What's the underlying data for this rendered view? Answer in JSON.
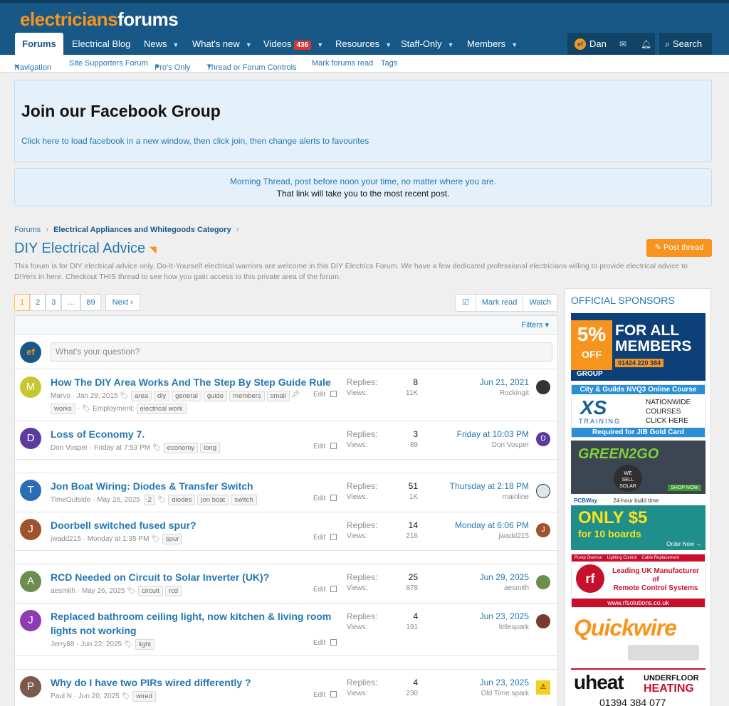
{
  "site": {
    "logo_a": "electricians",
    "logo_b": "forums"
  },
  "nav": {
    "tabs": [
      {
        "label": "Forums"
      },
      {
        "label": "Electrical Blog"
      },
      {
        "label": "News"
      },
      {
        "label": "What's new"
      },
      {
        "label": "Videos",
        "badge": "436"
      },
      {
        "label": "Resources"
      },
      {
        "label": "Staff-Only"
      },
      {
        "label": "Members"
      }
    ],
    "user": "Dan",
    "search": "Search"
  },
  "subnav": [
    "Navigation",
    "Site Supporters Forum",
    "Pro's Only",
    "Thread or Forum Controls",
    "Mark forums read",
    "Tags"
  ],
  "notice_fb": {
    "title": "Join our Facebook Group",
    "link": "Click here to load facebook in a new window, then click join, then change alerts to favourites"
  },
  "notice_morning": {
    "line1": "Morning Thread, post before noon your time, no matter where you are.",
    "line2": "That link will take you to the most recent post."
  },
  "breadcrumb": {
    "root": "Forums",
    "category": "Electrical Appliances and Whitegoods Category"
  },
  "forum": {
    "title": "DIY Electrical Advice",
    "post_thread": "Post thread",
    "description": "This forum is for DIY electrical advice only. Do-It-Yourself electrical warriors are welcome in this DIY Electrics Forum. We have a few dedicated professional electricians willing to provide electrical advice to DIYers in here. Checkout THIS thread to see how you gain access to this private area of the forum."
  },
  "pagination": {
    "pages": [
      "1",
      "2",
      "3",
      "…",
      "89"
    ],
    "next": "Next ›"
  },
  "actions": {
    "mark_read": "Mark read",
    "watch": "Watch"
  },
  "filters": "Filters ▾",
  "ask_placeholder": "What's your question?",
  "labels": {
    "replies": "Replies:",
    "views": "Views:",
    "edit": "Edit",
    "employment": "Employment:"
  },
  "threads": [
    {
      "title": "How The DIY Area Works And The Step By Step Guide Rule",
      "author": "Marvo",
      "date": "Jan 29, 2015",
      "tags": [
        "area",
        "diy",
        "general",
        "guide",
        "members",
        "small",
        "works"
      ],
      "extra_tag": "electrical work",
      "replies": "8",
      "views": "11K",
      "last_date": "Jun 21, 2021",
      "last_user": "Rockingit",
      "initial": "M",
      "color": "#c7c730"
    },
    {
      "title": "Loss of Economy 7.",
      "author": "Don Vosper",
      "date": "Friday at 7:53 PM",
      "tags": [
        "economy",
        "long"
      ],
      "replies": "3",
      "views": "89",
      "last_date": "Friday at 10:03 PM",
      "last_user": "Don Vosper",
      "initial": "D",
      "color": "#5c3a9e"
    },
    {
      "title": "Jon Boat Wiring: Diodes & Transfer Switch",
      "author": "TimeOutside",
      "date": "May 26, 2025",
      "pages_badge": "2",
      "tags": [
        "diodes",
        "jon boat",
        "switch"
      ],
      "replies": "51",
      "views": "1K",
      "last_date": "Thursday at 2:18 PM",
      "last_user": "mainline",
      "initial": "T",
      "color": "#2a6db5"
    },
    {
      "title": "Doorbell switched fused spur?",
      "author": "jwadd215",
      "date": "Monday at 1:35 PM",
      "tags": [
        "spur"
      ],
      "replies": "14",
      "views": "216",
      "last_date": "Monday at 6:06 PM",
      "last_user": "jwadd215",
      "initial": "J",
      "color": "#a0522d"
    },
    {
      "title": "RCD Needed on Circuit to Solar Inverter (UK)?",
      "author": "aesmith",
      "date": "May 26, 2025",
      "tags": [
        "circuit",
        "rcd"
      ],
      "replies": "25",
      "views": "878",
      "last_date": "Jun 29, 2025",
      "last_user": "aesmith",
      "initial": "A",
      "color": "#6b8e4e"
    },
    {
      "title": "Replaced bathroom ceiling light, now kitchen & living room lights not working",
      "author": "Jerry88",
      "date": "Jun 22, 2025",
      "tags": [
        "light"
      ],
      "replies": "4",
      "views": "191",
      "last_date": "Jun 23, 2025",
      "last_user": "littlespark",
      "initial": "J",
      "color": "#8e3cb5"
    },
    {
      "title": "Why do I have two PIRs wired differently ?",
      "author": "Paul N",
      "date": "Jun 20, 2025",
      "tags": [
        "wired"
      ],
      "replies": "4",
      "views": "230",
      "last_date": "Jun 23, 2025",
      "last_user": "Old Time spark",
      "initial": "P",
      "color": "#7a5a4a"
    }
  ],
  "sidebar": {
    "title": "OFFICIAL SPONSORS",
    "ad1": {
      "big": "5%",
      "off": "OFF",
      "for_all": "FOR ALL",
      "members": "MEMBERS",
      "phone": "01424 220 384",
      "group": "GROUP"
    },
    "ad2": {
      "top": "City & Guilds NVQ3 Online Course",
      "brand": "XS",
      "sub": "TRAINING",
      "l1": "NATIONWIDE",
      "l2": "COURSES",
      "l3": "CLICK HERE",
      "bottom": "Required for JIB Gold Card"
    },
    "ad3": {
      "text": "GREEN2GO",
      "shop": "SHOP NOW"
    },
    "ad4": {
      "brand": "PCBWay",
      "note": "24-hour build time",
      "big": "ONLY $5",
      "sub": "for 10 boards",
      "order": "Order Now →"
    },
    "ad5": {
      "top": "Pump Overrun    Lighting Control    Cable Replacement",
      "l1": "Leading UK Manufacturer",
      "l2": "of",
      "l3": "Remote Control Systems",
      "url": "www.rfsolutions.co.uk"
    },
    "ad6": {
      "text": "Quickwire"
    },
    "ad7": {
      "brand": "uheat",
      "l1": "UNDERFLOOR",
      "l2": "HEATING",
      "phone": "01394 384 077"
    }
  }
}
